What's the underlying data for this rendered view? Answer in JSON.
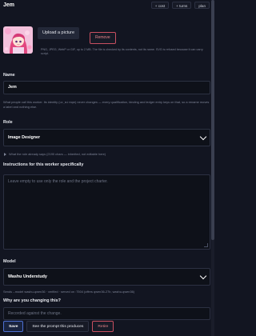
{
  "header": {
    "title": "Jem",
    "buttons": [
      "+ cost",
      "+ turns",
      "plan"
    ]
  },
  "picture": {
    "upload_label": "Upload a picture",
    "remove_label": "Remove",
    "hint": "PNG, JPEG, WebP or GIF, up to 2 MB. The file is checked by its contents, not its name. SVG is refused because it can carry script."
  },
  "name": {
    "label": "Name",
    "value": "Jem",
    "help_before": "What people call this worker. Its identity (",
    "help_code": "uc_mirage",
    "help_after": ") never changes — every qualification, binding and ledger entry keys on that, so a rename moves a label and nothing else."
  },
  "role": {
    "label": "Role",
    "value": "Image Designer",
    "disclosure": "What the role already says (2190 chars — inherited, not editable here)"
  },
  "instructions": {
    "label": "Instructions for this worker specifically",
    "placeholder": "Leave empty to use only the role and the project charter."
  },
  "model": {
    "label": "Model",
    "value": "Washu Understudy",
    "help": "Sends --model washu-qwen36 · verified · served on :7504 (offers qwen36-27b, washu-qwen36)"
  },
  "reason": {
    "label": "Why are you changing this?",
    "placeholder": "Recorded against the change."
  },
  "actions": {
    "save": "Save",
    "prompt": "See the prompt this produces",
    "retire": "Retire"
  },
  "colors": {
    "background": "#121521",
    "danger": "#c85060",
    "accent": "#4d6fd1"
  }
}
